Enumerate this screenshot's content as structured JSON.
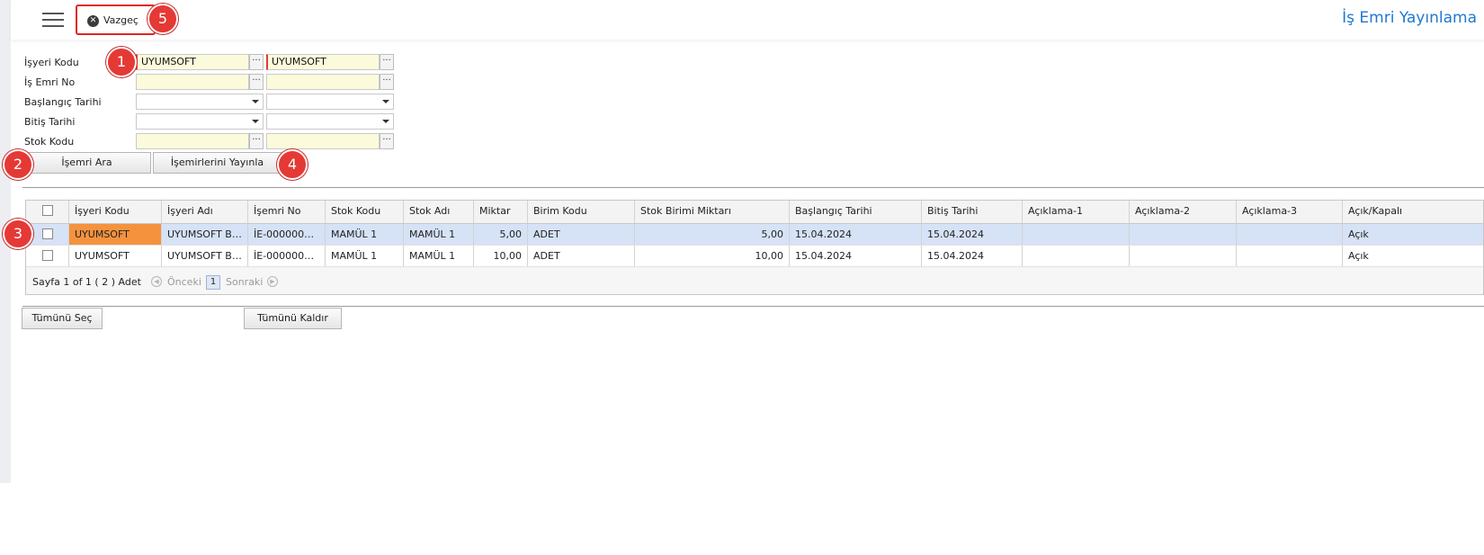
{
  "toolbar": {
    "cancel_label": "Vazgeç"
  },
  "page": {
    "title": "İş Emri Yayınlama"
  },
  "markers": [
    "1",
    "2",
    "3",
    "4",
    "5"
  ],
  "form": {
    "isyeri_kodu": {
      "label": "İşyeri Kodu",
      "from": "UYUMSOFT",
      "to": "UYUMSOFT"
    },
    "is_emri_no": {
      "label": "İş Emri No",
      "from": "",
      "to": ""
    },
    "baslangic_tarihi": {
      "label": "Başlangıç Tarihi"
    },
    "bitis_tarihi": {
      "label": "Bitiş Tarihi"
    },
    "stok_kodu": {
      "label": "Stok Kodu",
      "from": "",
      "to": ""
    },
    "lookup_glyph": "···",
    "search_button": "İşemri Ara",
    "publish_button": "İşemirlerini Yayınla"
  },
  "grid": {
    "columns": [
      "İşyeri Kodu",
      "İşyeri Adı",
      "İşemri No",
      "Stok Kodu",
      "Stok Adı",
      "Miktar",
      "Birim Kodu",
      "Stok Birimi Miktarı",
      "Başlangıç Tarihi",
      "Bitiş Tarihi",
      "Açıklama-1",
      "Açıklama-2",
      "Açıklama-3",
      "Açık/Kapalı"
    ],
    "rows": [
      [
        "UYUMSOFT",
        "UYUMSOFT Bİ...",
        "İE-0000000...",
        "MAMÜL 1",
        "MAMÜL 1",
        "5,00",
        "ADET",
        "5,00",
        "15.04.2024",
        "15.04.2024",
        "",
        "",
        "",
        "Açık"
      ],
      [
        "UYUMSOFT",
        "UYUMSOFT Bİ...",
        "İE-0000000...",
        "MAMÜL 1",
        "MAMÜL 1",
        "10,00",
        "ADET",
        "10,00",
        "15.04.2024",
        "15.04.2024",
        "",
        "",
        "",
        "Açık"
      ]
    ],
    "selected_row": 0,
    "pager": {
      "summary": "Sayfa 1 of 1 ( 2 ) Adet",
      "prev": "Önceki",
      "page": "1",
      "next": "Sonraki"
    }
  },
  "bottom": {
    "select_all": "Tümünü Seç",
    "clear_all": "Tümünü Kaldır"
  },
  "colors": {
    "accent": "#1f78d1",
    "marker": "#e53935",
    "selected_row": "#d6e2f6",
    "highlight_cell": "#f5923e",
    "lookup_field": "#fbfbdc"
  }
}
